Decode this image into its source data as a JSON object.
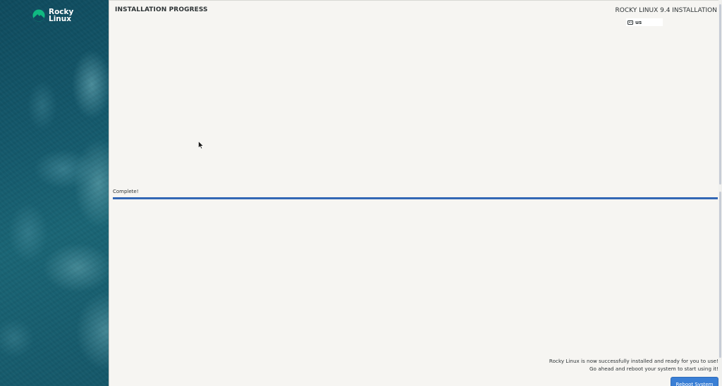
{
  "sidebar": {
    "logo_line1": "Rocky",
    "logo_line2": "Linux"
  },
  "header": {
    "page_title": "INSTALLATION PROGRESS",
    "product_title": "ROCKY LINUX 9.4 INSTALLATION",
    "keyboard_layout": "us"
  },
  "progress": {
    "status": "Complete!",
    "value": 1.0
  },
  "message": {
    "line1": "Rocky Linux is now successfully installed and ready for you to use!",
    "line2": "Go ahead and reboot your system to start using it!"
  },
  "actions": {
    "reboot_label": "Reboot System"
  },
  "colors": {
    "accent": "#3267b5",
    "button": "#3a7fd5",
    "background": "#f6f5f2",
    "sidebar": "#14586b",
    "logo_mark": "#10b981"
  },
  "icons": {
    "logo": "rocky-linux-logo-icon",
    "keyboard": "keyboard-icon",
    "cursor": "mouse-pointer-icon"
  }
}
